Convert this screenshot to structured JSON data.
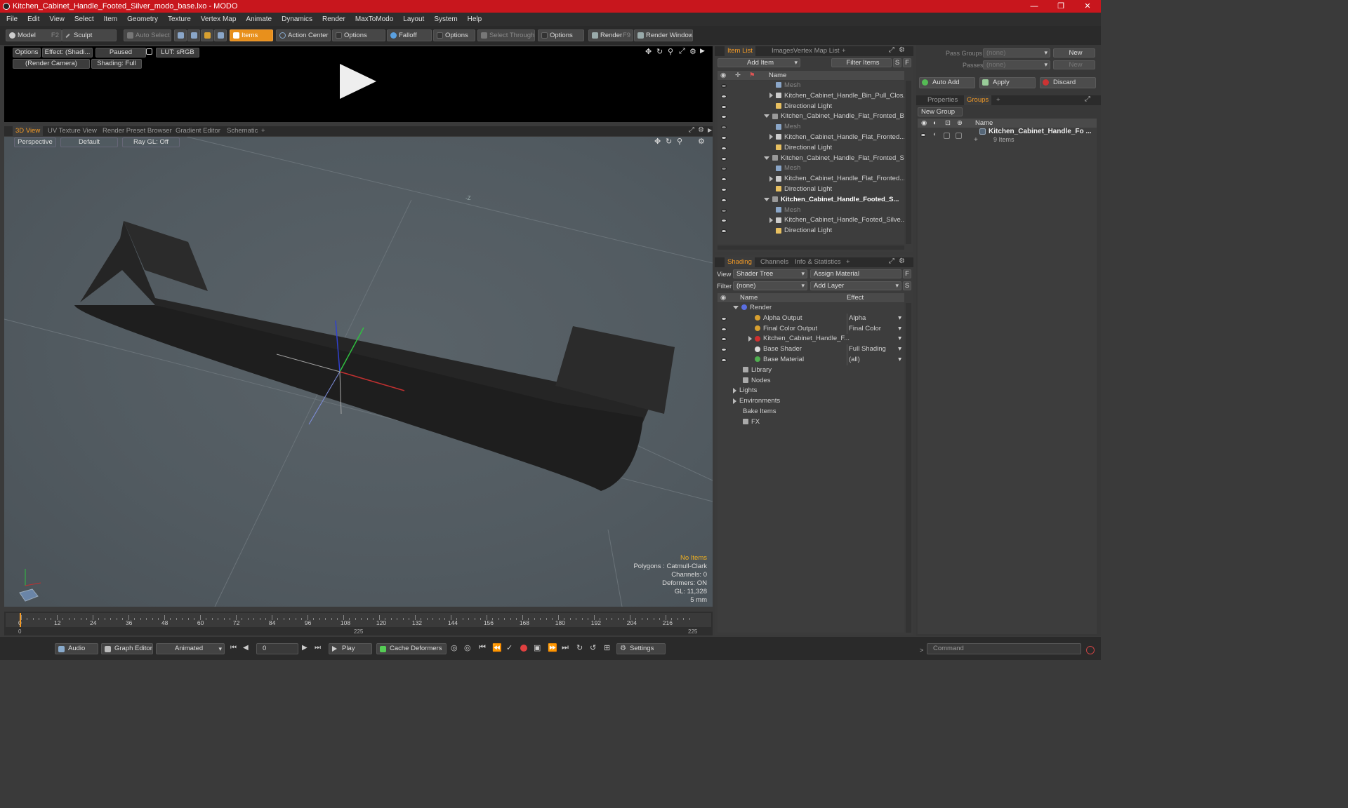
{
  "window": {
    "title": "Kitchen_Cabinet_Handle_Footed_Silver_modo_base.lxo - MODO",
    "min": "—",
    "max": "❐",
    "close": "✕"
  },
  "menu": [
    "File",
    "Edit",
    "View",
    "Select",
    "Item",
    "Geometry",
    "Texture",
    "Vertex Map",
    "Animate",
    "Dynamics",
    "Render",
    "MaxToModo",
    "Layout",
    "System",
    "Help"
  ],
  "toolbar": {
    "model": "Model",
    "model_key": "F2",
    "sculpt": "Sculpt",
    "auto_select": "Auto Select",
    "items": "Items",
    "action_center": "Action Center",
    "options1": "Options",
    "falloff": "Falloff",
    "options2": "Options",
    "select_through": "Select Through",
    "options3": "Options",
    "render": "Render",
    "render_key": "F9",
    "render_window": "Render Window"
  },
  "preview": {
    "options": "Options",
    "effect": "Effect: (Shadi...",
    "paused": "Paused",
    "lut": "LUT: sRGB",
    "camera": "(Render Camera)",
    "shading": "Shading: Full"
  },
  "viewtabs": [
    "3D View",
    "UV Texture View",
    "Render Preset Browser",
    "Gradient Editor",
    "Schematic",
    "+"
  ],
  "viewport": {
    "perspective": "Perspective",
    "default": "Default",
    "raygl": "Ray GL: Off",
    "no_items": "No Items",
    "polygons": "Polygons : Catmull-Clark",
    "channels": "Channels: 0",
    "deformers": "Deformers: ON",
    "gl": "GL: 11,328",
    "scale": "5 mm",
    "axis_label": "-Z"
  },
  "timeline": {
    "ticks": [
      "0",
      "12",
      "24",
      "36",
      "48",
      "60",
      "72",
      "84",
      "96",
      "108",
      "120",
      "132",
      "144",
      "156",
      "168",
      "180",
      "192",
      "204",
      "216"
    ],
    "start": "0",
    "mid": "225",
    "end": "225"
  },
  "bottombar": {
    "audio": "Audio",
    "graph_editor": "Graph Editor",
    "animated": "Animated",
    "frame": "0",
    "play": "Play",
    "cache_deformers": "Cache Deformers",
    "settings": "Settings",
    "command": "Command"
  },
  "itemlist": {
    "tabs": [
      "Item List",
      "Images",
      "Vertex Map List",
      "+"
    ],
    "add_item": "Add Item",
    "filter_items": "Filter Items",
    "s": "S",
    "f": "F",
    "col_name": "Name",
    "rows": [
      {
        "label": "Mesh",
        "indent": 2,
        "kind": "mesh"
      },
      {
        "label": "Kitchen_Cabinet_Handle_Bin_Pull_Clos...",
        "indent": 2,
        "kind": "group"
      },
      {
        "label": "Directional Light",
        "indent": 2,
        "kind": "light"
      },
      {
        "label": "Kitchen_Cabinet_Handle_Flat_Fronted_B...",
        "indent": 1,
        "kind": "scene"
      },
      {
        "label": "Mesh",
        "indent": 2,
        "kind": "mesh"
      },
      {
        "label": "Kitchen_Cabinet_Handle_Flat_Fronted...",
        "indent": 2,
        "kind": "group"
      },
      {
        "label": "Directional Light",
        "indent": 2,
        "kind": "light"
      },
      {
        "label": "Kitchen_Cabinet_Handle_Flat_Fronted_S...",
        "indent": 1,
        "kind": "scene"
      },
      {
        "label": "Mesh",
        "indent": 2,
        "kind": "mesh"
      },
      {
        "label": "Kitchen_Cabinet_Handle_Flat_Fronted...",
        "indent": 2,
        "kind": "group"
      },
      {
        "label": "Directional Light",
        "indent": 2,
        "kind": "light"
      },
      {
        "label": "Kitchen_Cabinet_Handle_Footed_S...",
        "indent": 1,
        "kind": "scene"
      },
      {
        "label": "Mesh",
        "indent": 2,
        "kind": "mesh"
      },
      {
        "label": "Kitchen_Cabinet_Handle_Footed_Silve...",
        "indent": 2,
        "kind": "group"
      },
      {
        "label": "Directional Light",
        "indent": 2,
        "kind": "light"
      }
    ]
  },
  "shading": {
    "tabs": [
      "Shading",
      "Channels",
      "Info & Statistics",
      "+"
    ],
    "view_label": "View",
    "view_value": "Shader Tree",
    "assign_material": "Assign Material",
    "filter_label": "Filter",
    "filter_value": "(none)",
    "add_layer": "Add Layer",
    "col_name": "Name",
    "col_effect": "Effect",
    "f": "F",
    "s": "S",
    "rows": [
      {
        "label": "Render",
        "effect": "",
        "indent": 0,
        "color": "#5a6ee0"
      },
      {
        "label": "Alpha Output",
        "effect": "Alpha",
        "indent": 1,
        "color": "#d8a030"
      },
      {
        "label": "Final Color Output",
        "effect": "Final Color",
        "indent": 1,
        "color": "#d8a030"
      },
      {
        "label": "Kitchen_Cabinet_Handle_F...",
        "effect": "",
        "indent": 1,
        "color": "#d03030"
      },
      {
        "label": "Base Shader",
        "effect": "Full Shading",
        "indent": 1,
        "color": "#dddddd"
      },
      {
        "label": "Base Material",
        "effect": "(all)",
        "indent": 1,
        "color": "#50b050"
      },
      {
        "label": "Library",
        "effect": "",
        "indent": 0,
        "color": ""
      },
      {
        "label": "Nodes",
        "effect": "",
        "indent": 0,
        "color": ""
      },
      {
        "label": "Lights",
        "effect": "",
        "indent": 0,
        "color": ""
      },
      {
        "label": "Environments",
        "effect": "",
        "indent": 0,
        "color": ""
      },
      {
        "label": "Bake Items",
        "effect": "",
        "indent": 0,
        "color": ""
      },
      {
        "label": "FX",
        "effect": "",
        "indent": 0,
        "color": ""
      }
    ]
  },
  "right": {
    "pass_groups": "Pass Groups",
    "pass_groups_value": "(none)",
    "new": "New",
    "passes": "Passes",
    "passes_value": "(none)",
    "new2": "New",
    "auto_add": "Auto Add",
    "apply": "Apply",
    "discard": "Discard",
    "tabs": [
      "Properties",
      "Groups",
      "+"
    ],
    "new_group": "New Group",
    "col_name": "Name",
    "group_name": "Kitchen_Cabinet_Handle_Fo ...",
    "group_count": "9 Items"
  }
}
